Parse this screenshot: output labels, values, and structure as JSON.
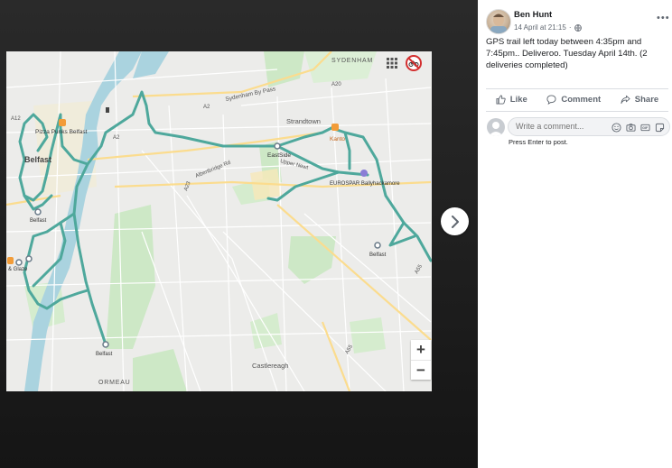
{
  "post": {
    "author": "Ben Hunt",
    "timestamp": "14 April at 21:15",
    "privacy_separator": "·",
    "text": "GPS trail left today between 4:35pm and 7:45pm.. Deliveroo. Tuesday April 14th. (2 deliveries completed)",
    "more_label": "•••"
  },
  "actions": {
    "like": "Like",
    "comment": "Comment",
    "share": "Share"
  },
  "comment_box": {
    "placeholder": "Write a comment...",
    "hint": "Press Enter to post."
  },
  "map": {
    "zoom_in": "+",
    "zoom_out": "−",
    "route_color": "#4ea89c",
    "labels": {
      "sydenham": "SYDENHAM",
      "sydenham_bypass": "Sydenham By Pass",
      "strandtown": "Strandtown",
      "eastside": "EastSide",
      "upper_newtownards": "Upper Newt",
      "albertbridge": "Albertbridge Rd",
      "kanto": "Kanto",
      "eurospar": "EUROSPAR Ballyhackamore",
      "belfast_east": "Belfast",
      "pizza_punks": "Pizza Punks Belfast",
      "belfast_centre": "Belfast",
      "belfast_west": "Belfast",
      "glaze": "& Glaze",
      "belfast_south": "Belfast",
      "ormeau": "ORMEAU",
      "castlereagh": "Castlereagh",
      "a2": "A2",
      "a12": "A12",
      "a55": "A55",
      "a55b": "A55",
      "a20": "A20",
      "a23": "A23"
    }
  }
}
